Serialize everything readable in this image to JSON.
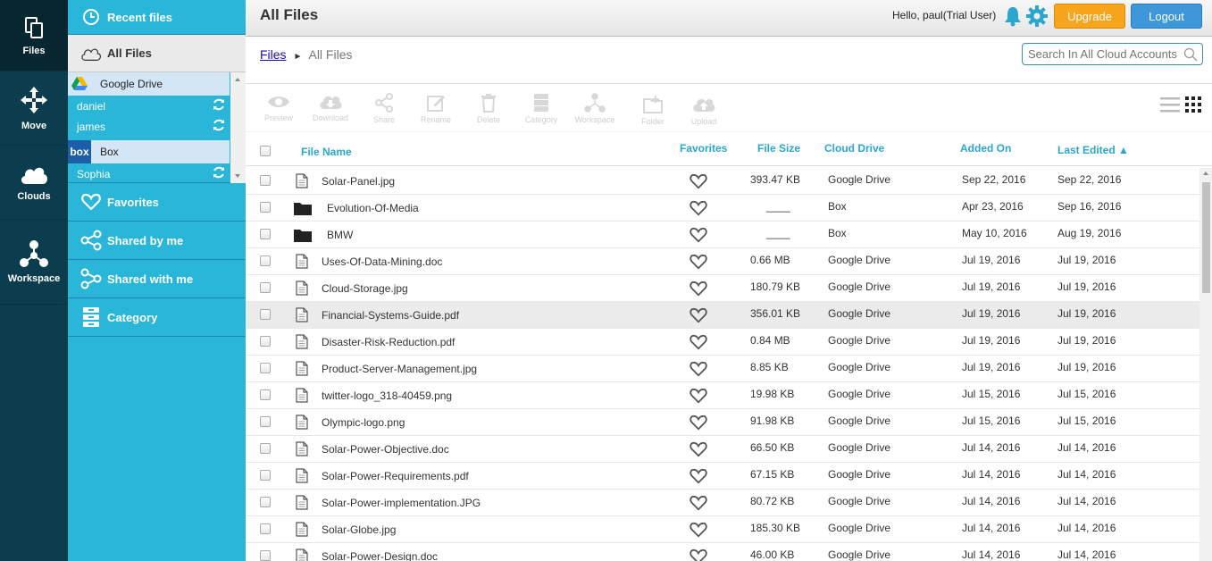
{
  "rail": {
    "items": [
      {
        "label": "Files",
        "icon": "files-icon"
      },
      {
        "label": "Move",
        "icon": "move-icon"
      },
      {
        "label": "Clouds",
        "icon": "cloud-icon"
      },
      {
        "label": "Workspace",
        "icon": "workspace-icon"
      }
    ]
  },
  "sidebar": {
    "recent": "Recent files",
    "all_files": "All Files",
    "clouds": [
      {
        "name": "Google Drive",
        "users": [
          "daniel",
          "james"
        ]
      },
      {
        "name": "Box",
        "users": [
          "Sophia"
        ]
      }
    ],
    "box_logo_text": "box",
    "favorites": "Favorites",
    "shared_by_me": "Shared by me",
    "shared_with_me": "Shared with me",
    "category": "Category"
  },
  "header": {
    "title": "All Files",
    "greeting": "Hello, paul(Trial User)",
    "upgrade": "Upgrade",
    "logout": "Logout"
  },
  "breadcrumb": {
    "root": "Files",
    "separator": "►",
    "current": "All Files"
  },
  "search": {
    "placeholder": "Search In All Cloud Accounts"
  },
  "toolbar": {
    "tools": [
      "Preview",
      "Download",
      "Share",
      "Rename",
      "Delete",
      "Category",
      "Workspace",
      "Folder",
      "Upload"
    ]
  },
  "table": {
    "columns": {
      "name": "File Name",
      "favorites": "Favorites",
      "size": "File Size",
      "cloud": "Cloud Drive",
      "added": "Added On",
      "edited": "Last Edited ▲"
    },
    "rows": [
      {
        "type": "file",
        "name": "Solar-Panel.jpg",
        "size": "393.47 KB",
        "cloud": "Google Drive",
        "added": "Sep 22, 2016",
        "edited": "Sep 22, 2016"
      },
      {
        "type": "folder",
        "name": "Evolution-Of-Media",
        "size": "____",
        "cloud": "Box",
        "added": "Apr 23, 2016",
        "edited": "Sep 16, 2016"
      },
      {
        "type": "folder",
        "name": "BMW",
        "size": "____",
        "cloud": "Box",
        "added": "May 10, 2016",
        "edited": "Aug 19, 2016"
      },
      {
        "type": "file",
        "name": "Uses-Of-Data-Mining.doc",
        "size": "0.66 MB",
        "cloud": "Google Drive",
        "added": "Jul 19, 2016",
        "edited": "Jul 19, 2016"
      },
      {
        "type": "file",
        "name": "Cloud-Storage.jpg",
        "size": "180.79 KB",
        "cloud": "Google Drive",
        "added": "Jul 19, 2016",
        "edited": "Jul 19, 2016"
      },
      {
        "type": "file",
        "name": "Financial-Systems-Guide.pdf",
        "size": "356.01 KB",
        "cloud": "Google Drive",
        "added": "Jul 19, 2016",
        "edited": "Jul 19, 2016",
        "highlight": true
      },
      {
        "type": "file",
        "name": "Disaster-Risk-Reduction.pdf",
        "size": "0.84 MB",
        "cloud": "Google Drive",
        "added": "Jul 19, 2016",
        "edited": "Jul 19, 2016"
      },
      {
        "type": "file",
        "name": "Product-Server-Management.jpg",
        "size": "8.85 KB",
        "cloud": "Google Drive",
        "added": "Jul 19, 2016",
        "edited": "Jul 19, 2016"
      },
      {
        "type": "file",
        "name": "twitter-logo_318-40459.png",
        "size": "19.98 KB",
        "cloud": "Google Drive",
        "added": "Jul 15, 2016",
        "edited": "Jul 15, 2016"
      },
      {
        "type": "file",
        "name": "Olympic-logo.png",
        "size": "91.98 KB",
        "cloud": "Google Drive",
        "added": "Jul 15, 2016",
        "edited": "Jul 15, 2016"
      },
      {
        "type": "file",
        "name": "Solar-Power-Objective.doc",
        "size": "66.50 KB",
        "cloud": "Google Drive",
        "added": "Jul 14, 2016",
        "edited": "Jul 14, 2016"
      },
      {
        "type": "file",
        "name": "Solar-Power-Requirements.pdf",
        "size": "67.15 KB",
        "cloud": "Google Drive",
        "added": "Jul 14, 2016",
        "edited": "Jul 14, 2016"
      },
      {
        "type": "file",
        "name": "Solar-Power-implementation.JPG",
        "size": "80.72 KB",
        "cloud": "Google Drive",
        "added": "Jul 14, 2016",
        "edited": "Jul 14, 2016"
      },
      {
        "type": "file",
        "name": "Solar-Globe.jpg",
        "size": "185.30 KB",
        "cloud": "Google Drive",
        "added": "Jul 14, 2016",
        "edited": "Jul 14, 2016"
      },
      {
        "type": "file",
        "name": "Solar-Power-Design.doc",
        "size": "46.00 KB",
        "cloud": "Google Drive",
        "added": "Jul 14, 2016",
        "edited": "Jul 14, 2016"
      }
    ]
  },
  "colors": {
    "rail": "#0c3d4e",
    "sidebar": "#29b6d9",
    "accent": "#2aa6cf",
    "upgrade": "#f7a51c",
    "logout": "#3d97d9"
  }
}
